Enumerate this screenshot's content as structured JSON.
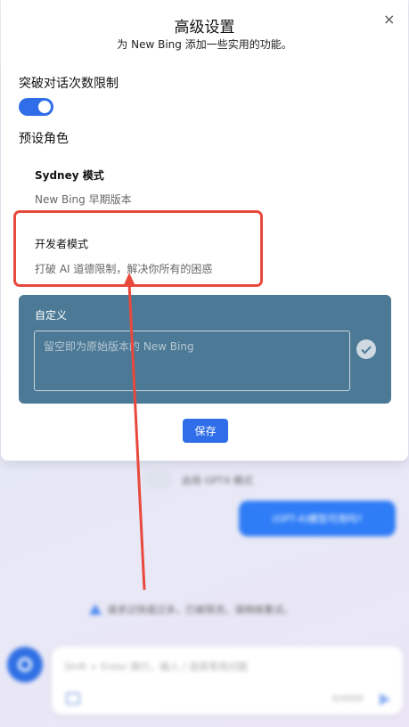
{
  "dialog": {
    "title": "高级设置",
    "subtitle": "为 New Bing 添加一些实用的功能。",
    "close_icon": "×",
    "breakout_label": "突破对话次数限制",
    "breakout_enabled": true,
    "preset_label": "预设角色",
    "options": [
      {
        "title": "Sydney 模式",
        "desc": "New Bing 早期版本"
      },
      {
        "title": "开发者模式",
        "desc": "打破 AI 道德限制，解决你所有的困惑"
      }
    ],
    "custom": {
      "label": "自定义",
      "placeholder": "留空即为原始版本的 New Bing"
    },
    "save_label": "保存"
  },
  "background": {
    "gpt4_label": "启用 GPT4 模式",
    "bubble_text": "(GPT-4)模型可用吗?",
    "notice": "请求过快或过多，已被限流，请稍候重试。",
    "input_placeholder": "Shift + Enter 换行，输入 / 选择常用问题",
    "counter": "0/4000"
  },
  "colors": {
    "accent": "#2f6ee8",
    "custom_panel": "#4c7a96",
    "annotation": "#e8493c"
  }
}
